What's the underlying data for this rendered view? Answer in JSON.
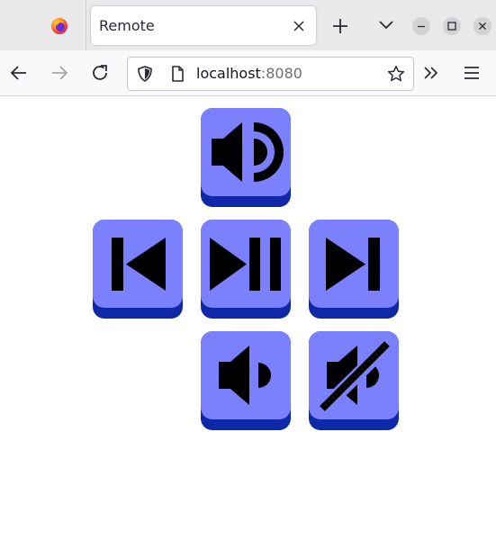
{
  "browser": {
    "tab_title": "Remote",
    "url_host": "localhost",
    "url_port": ":8080"
  },
  "remote": {
    "buttons": [
      {
        "name": "volume-up",
        "icon": "volume-up-icon"
      },
      {
        "name": "previous-track",
        "icon": "skip-previous-icon"
      },
      {
        "name": "play-pause",
        "icon": "play-pause-icon"
      },
      {
        "name": "next-track",
        "icon": "skip-next-icon"
      },
      {
        "name": "volume-down",
        "icon": "volume-down-icon"
      },
      {
        "name": "mute",
        "icon": "mute-icon"
      }
    ],
    "colors": {
      "button_face": "#7b80fe",
      "button_shadow": "#1029a8",
      "icon": "#000000"
    }
  }
}
